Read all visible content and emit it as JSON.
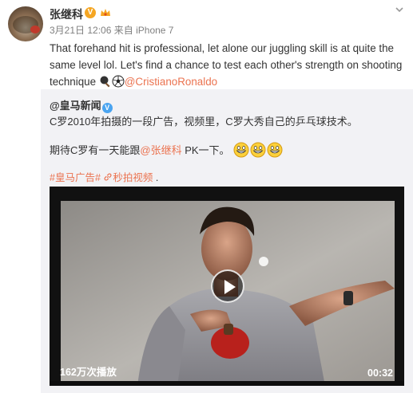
{
  "post": {
    "username": "张继科",
    "verified_badge": "V",
    "date": "3月21日 12:06",
    "source_prefix": "来自",
    "source": "iPhone 7",
    "text": "That forehand hit is professional, let alone our juggling skill is at quite the same level lol. Let's find a chance to test each other's strength on shooting technique",
    "emoji_icons": [
      "ping-pong-paddle-icon",
      "soccer-ball-icon"
    ],
    "mention": "@CristianoRonaldo"
  },
  "repost": {
    "author": "@皇马新闻",
    "author_badge": "V",
    "line1": "C罗2010年拍摄的一段广告，视频里，C罗大秀自己的乒乓球技术。",
    "line2_prefix": "期待C罗有一天能跟",
    "line2_mention": "@张继科",
    "line2_suffix": " PK一下。",
    "emoji_count": 3,
    "tag": "#皇马广告#",
    "video_link": "秒拍视频",
    "trailing": " ."
  },
  "video": {
    "views": "162万次播放",
    "duration": "00:32"
  },
  "colors": {
    "link": "#eb7350",
    "repost_bg": "#f2f2f5",
    "verified_orange": "#f5a623",
    "verified_blue": "#4aa4f0"
  }
}
